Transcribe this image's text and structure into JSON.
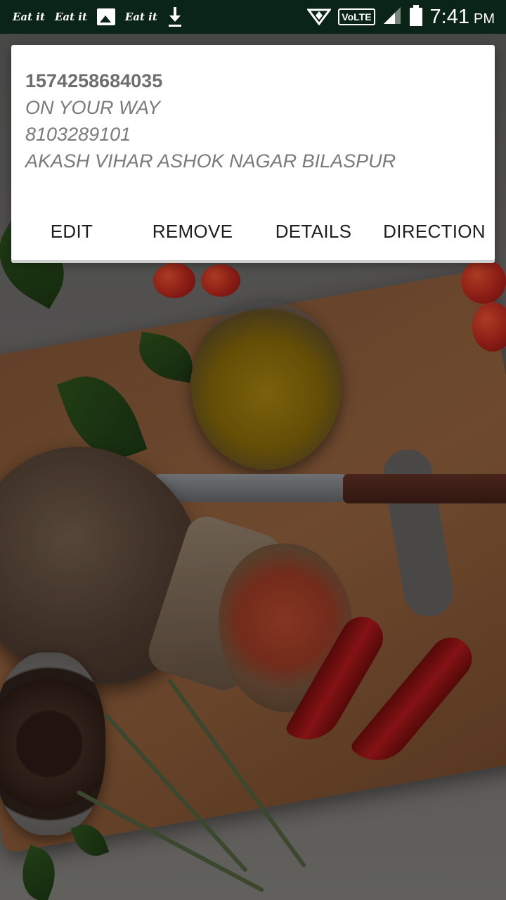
{
  "status_bar": {
    "app_badges": [
      "Eat it",
      "Eat it",
      "Eat it"
    ],
    "network": "VoLTE",
    "time": "7:41",
    "ampm": "PM",
    "icons": [
      "eat-it-notification",
      "eat-it-notification",
      "image-notification",
      "eat-it-notification",
      "download-notification",
      "data-saver-icon",
      "volte-icon",
      "signal-icon",
      "battery-icon"
    ]
  },
  "order_card": {
    "order_id": "1574258684035",
    "status": "ON YOUR WAY",
    "phone": "8103289101",
    "address": "AKASH VIHAR ASHOK NAGAR BILASPUR"
  },
  "actions": {
    "edit": "EDIT",
    "remove": "REMOVE",
    "details": "DETAILS",
    "direction": "DIRECTION"
  }
}
